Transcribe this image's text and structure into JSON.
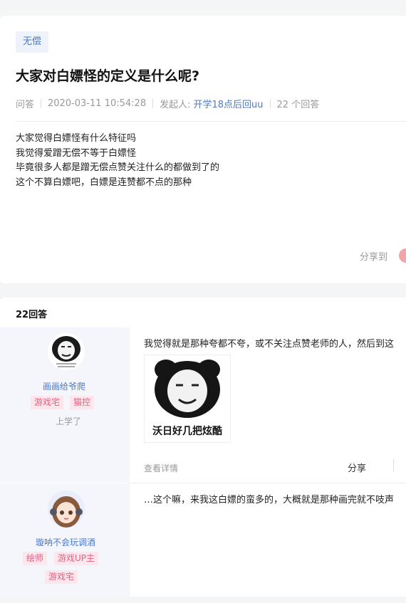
{
  "question": {
    "tag": "无偿",
    "title": "大家对白嫖怪的定义是什么呢?",
    "type_label": "问答",
    "timestamp": "2020-03-11 10:54:28",
    "author_prefix": "发起人:",
    "author": "开学18点后回uu",
    "answer_count": "22 个回答",
    "body": [
      "大家觉得白嫖怪有什么特征吗",
      "我觉得爱蹭无偿不等于白嫖怪",
      "毕竟很多人都是蹭无偿点赞关注什么的都做到了的",
      "这个不算白嫖吧，白嫖是连赞都不点的那种"
    ],
    "share_label": "分享到"
  },
  "answers_header": "22回答",
  "answers": [
    {
      "username": "画画给爷爬",
      "badges": [
        "游戏宅",
        "猫控"
      ],
      "rank": "上学了",
      "text": "我觉得就是那种夸都不夸，或不关注点赞老师的人，然后到这",
      "meme_caption": "沃日好几把炫酷",
      "detail_label": "查看详情",
      "share_label": "分享"
    },
    {
      "username": "璇呐不会玩调酒",
      "badges": [
        "绘师",
        "游戏UP主",
        "游戏宅"
      ],
      "text": "…这个嘛，来我这白嫖的蛮多的，大概就是那种画完就不吱声"
    }
  ],
  "colors": {
    "accent": "#4c79c7",
    "badge_bg": "#fde7ec",
    "badge_text": "#e06183",
    "user_col_bg": "#f5f6fc"
  }
}
